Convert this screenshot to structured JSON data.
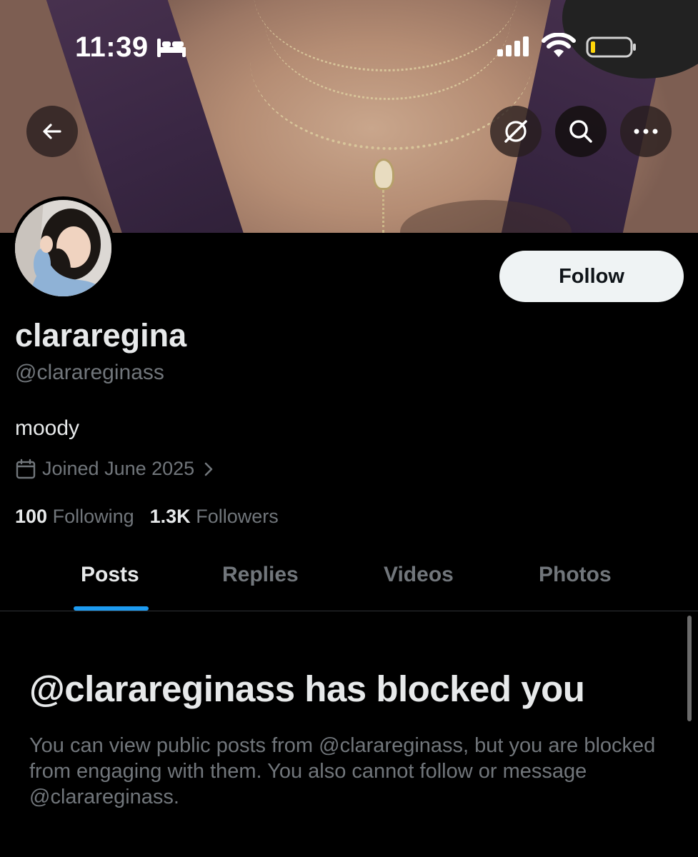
{
  "status_bar": {
    "time": "11:39",
    "icons": [
      "bed-icon",
      "cellular-signal-icon",
      "wifi-icon",
      "battery-low-icon"
    ],
    "battery_color": "#ffd60a"
  },
  "header": {
    "buttons": [
      "back-arrow-icon",
      "grok-icon",
      "search-icon",
      "more-icon"
    ]
  },
  "profile": {
    "display_name": "clararegina",
    "handle": "@clarareginass",
    "bio": "moody",
    "joined": "Joined June 2025",
    "following_count": "100",
    "following_label": "Following",
    "followers_count": "1.3K",
    "followers_label": "Followers",
    "follow_label": "Follow"
  },
  "tabs": [
    {
      "label": "Posts",
      "active": true
    },
    {
      "label": "Replies",
      "active": false
    },
    {
      "label": "Videos",
      "active": false
    },
    {
      "label": "Photos",
      "active": false
    }
  ],
  "blocked": {
    "title": "@clarareginass has blocked you",
    "body": "You can view public posts from @clarareginass, but you are blocked from engaging with them. You also cannot follow or message @clarareginass."
  },
  "colors": {
    "accent": "#1d9bf0",
    "background": "#000000",
    "text_primary": "#e7e9ea",
    "text_secondary": "#71767b"
  }
}
